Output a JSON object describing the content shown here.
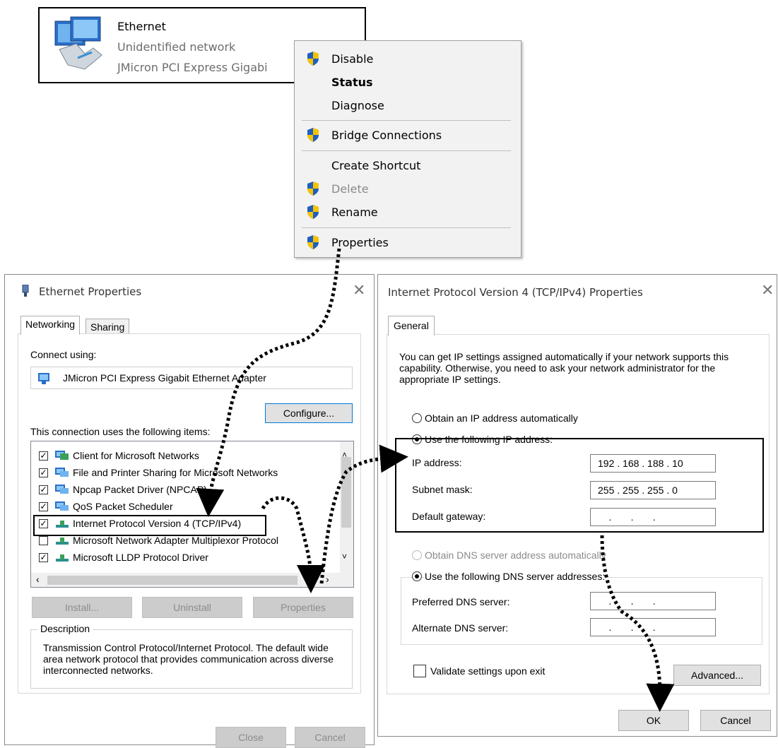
{
  "ethernet_tile": {
    "name": "Ethernet",
    "status": "Unidentified network",
    "adapter": "JMicron PCI Express Gigabi"
  },
  "context_menu": {
    "items": [
      {
        "label": "Disable",
        "shield": true,
        "bold": false,
        "disabled": false
      },
      {
        "label": "Status",
        "shield": false,
        "bold": true,
        "disabled": false
      },
      {
        "label": "Diagnose",
        "shield": false,
        "bold": false,
        "disabled": false
      },
      {
        "label": "Bridge Connections",
        "shield": true,
        "bold": false,
        "disabled": false
      },
      {
        "label": "Create Shortcut",
        "shield": false,
        "bold": false,
        "disabled": false
      },
      {
        "label": "Delete",
        "shield": true,
        "bold": false,
        "disabled": true
      },
      {
        "label": "Rename",
        "shield": true,
        "bold": false,
        "disabled": false
      },
      {
        "label": "Properties",
        "shield": true,
        "bold": false,
        "disabled": false
      }
    ]
  },
  "ethernet_properties": {
    "title": "Ethernet Properties",
    "tabs": [
      "Networking",
      "Sharing"
    ],
    "connect_using_label": "Connect using:",
    "adapter_name": "JMicron PCI Express Gigabit Ethernet Adapter",
    "configure_label": "Configure...",
    "items_label": "This connection uses the following items:",
    "items": [
      {
        "label": "Client for Microsoft Networks",
        "checked": true,
        "icon": "network-client-icon"
      },
      {
        "label": "File and Printer Sharing for Microsoft Networks",
        "checked": true,
        "icon": "network-service-icon"
      },
      {
        "label": "Npcap Packet Driver (NPCAP)",
        "checked": true,
        "icon": "network-service-icon"
      },
      {
        "label": "QoS Packet Scheduler",
        "checked": true,
        "icon": "network-service-icon"
      },
      {
        "label": "Internet Protocol Version 4 (TCP/IPv4)",
        "checked": true,
        "icon": "protocol-icon"
      },
      {
        "label": "Microsoft Network Adapter Multiplexor Protocol",
        "checked": false,
        "icon": "protocol-icon"
      },
      {
        "label": "Microsoft LLDP Protocol Driver",
        "checked": true,
        "icon": "protocol-icon"
      }
    ],
    "install_label": "Install...",
    "uninstall_label": "Uninstall",
    "properties_label": "Properties",
    "description_label": "Description",
    "description_text": "Transmission Control Protocol/Internet Protocol. The default wide area network protocol that provides communication across diverse interconnected networks.",
    "close_label": "Close",
    "cancel_label": "Cancel"
  },
  "ipv4_properties": {
    "title": "Internet Protocol Version 4 (TCP/IPv4) Properties",
    "tab": "General",
    "intro": "You can get IP settings assigned automatically if your network supports this capability. Otherwise, you need to ask your network administrator for the appropriate IP settings.",
    "obtain_ip_label": "Obtain an IP address automatically",
    "use_ip_label": "Use the following IP address:",
    "ip_address_label": "IP address:",
    "ip_address_value": "192 . 168 . 188 . 10",
    "subnet_mask_label": "Subnet mask:",
    "subnet_mask_value": "255 . 255 . 255 . 0",
    "default_gateway_label": "Default gateway:",
    "default_gateway_value": "    .       .       .",
    "obtain_dns_label": "Obtain DNS server address automatically",
    "use_dns_label": "Use the following DNS server addresses:",
    "preferred_dns_label": "Preferred DNS server:",
    "preferred_dns_value": "    .       .       .",
    "alternate_dns_label": "Alternate DNS server:",
    "alternate_dns_value": "    .       .       .",
    "validate_label": "Validate settings upon exit",
    "advanced_label": "Advanced...",
    "ok_label": "OK",
    "cancel_label": "Cancel"
  },
  "colors": {
    "shield_blue": "#1f5fbf",
    "shield_yellow": "#f5c400",
    "dialog_border": "#8a8a8a",
    "button_face": "#e1e1e1"
  }
}
